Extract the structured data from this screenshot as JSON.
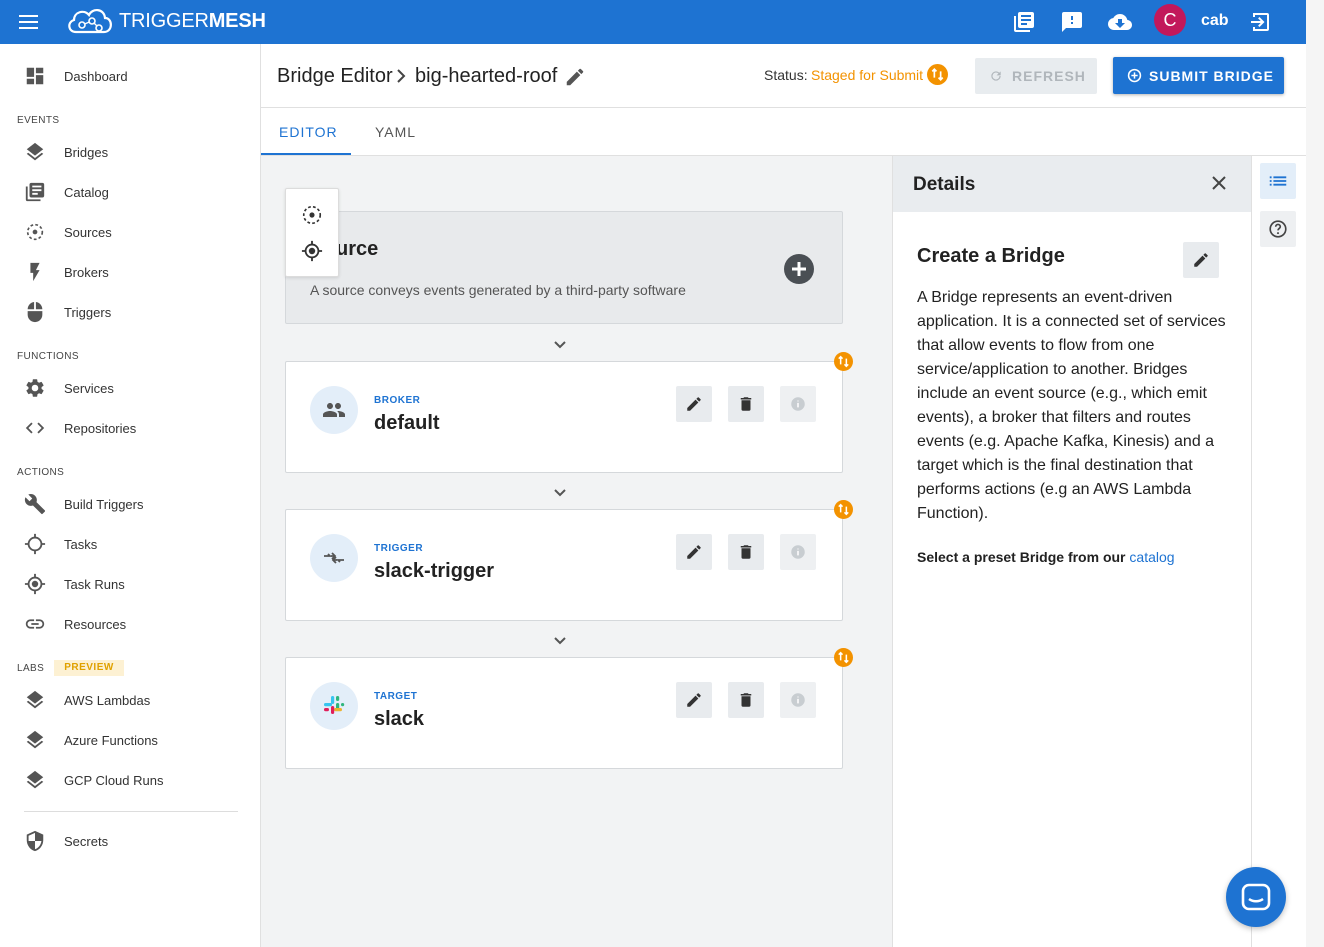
{
  "app": {
    "brand_light": "TRIGGER",
    "brand_bold": "MESH",
    "user_initial": "C",
    "user_name": "cab",
    "accent_color": "#1e73d2",
    "status_color": "#f39200",
    "avatar_color": "#c2185b"
  },
  "topbar": {
    "icons": [
      "docs-icon",
      "feedback-icon",
      "cloud-download-icon",
      "logout-icon"
    ]
  },
  "sidebar": {
    "top_items": [
      {
        "label": "Dashboard",
        "icon": "dashboard-icon"
      }
    ],
    "sections": [
      {
        "title": "EVENTS",
        "items": [
          {
            "label": "Bridges",
            "icon": "layers-icon"
          },
          {
            "label": "Catalog",
            "icon": "catalog-icon"
          },
          {
            "label": "Sources",
            "icon": "source-icon"
          },
          {
            "label": "Brokers",
            "icon": "bolt-icon"
          },
          {
            "label": "Triggers",
            "icon": "mouse-icon"
          }
        ]
      },
      {
        "title": "FUNCTIONS",
        "items": [
          {
            "label": "Services",
            "icon": "gear-icon"
          },
          {
            "label": "Repositories",
            "icon": "code-icon"
          }
        ]
      },
      {
        "title": "ACTIONS",
        "items": [
          {
            "label": "Build Triggers",
            "icon": "wrench-icon"
          },
          {
            "label": "Tasks",
            "icon": "crosshair-icon"
          },
          {
            "label": "Task Runs",
            "icon": "target-icon"
          },
          {
            "label": "Resources",
            "icon": "link-icon"
          }
        ]
      },
      {
        "title": "LABS",
        "badge": "PREVIEW",
        "items": [
          {
            "label": "AWS Lambdas",
            "icon": "layers-icon"
          },
          {
            "label": "Azure Functions",
            "icon": "layers-icon"
          },
          {
            "label": "GCP Cloud Runs",
            "icon": "layers-icon"
          }
        ]
      }
    ],
    "bottom_items": [
      {
        "label": "Secrets",
        "icon": "shield-icon"
      }
    ]
  },
  "header": {
    "crumb_root": "Bridge Editor",
    "crumb_name": "big-hearted-roof",
    "status_label": "Status:",
    "status_value": "Staged for Submit",
    "refresh_label": "REFRESH",
    "submit_label": "SUBMIT BRIDGE"
  },
  "tabs": [
    {
      "label": "EDITOR",
      "active": true
    },
    {
      "label": "YAML",
      "active": false
    }
  ],
  "editor": {
    "source": {
      "title": "Source",
      "visible_title": "urce",
      "description": "A source conveys events generated by a third-party software"
    },
    "cards": [
      {
        "type": "BROKER",
        "name": "default",
        "icon": "broker-icon"
      },
      {
        "type": "TRIGGER",
        "name": "slack-trigger",
        "icon": "trigger-icon"
      },
      {
        "type": "TARGET",
        "name": "slack",
        "icon": "slack-icon"
      }
    ]
  },
  "details": {
    "title": "Details",
    "heading": "Create a Bridge",
    "body": "A Bridge represents an event-driven application. It is a connected set of services that allow events to flow from one service/application to another. Bridges include an event source (e.g., which emit events), a broker that filters and routes events (e.g. Apache Kafka, Kinesis) and a target which is the final destination that performs actions (e.g an AWS Lambda Function).",
    "catalog_prefix": "Select a preset Bridge from our ",
    "catalog_link": "catalog"
  }
}
